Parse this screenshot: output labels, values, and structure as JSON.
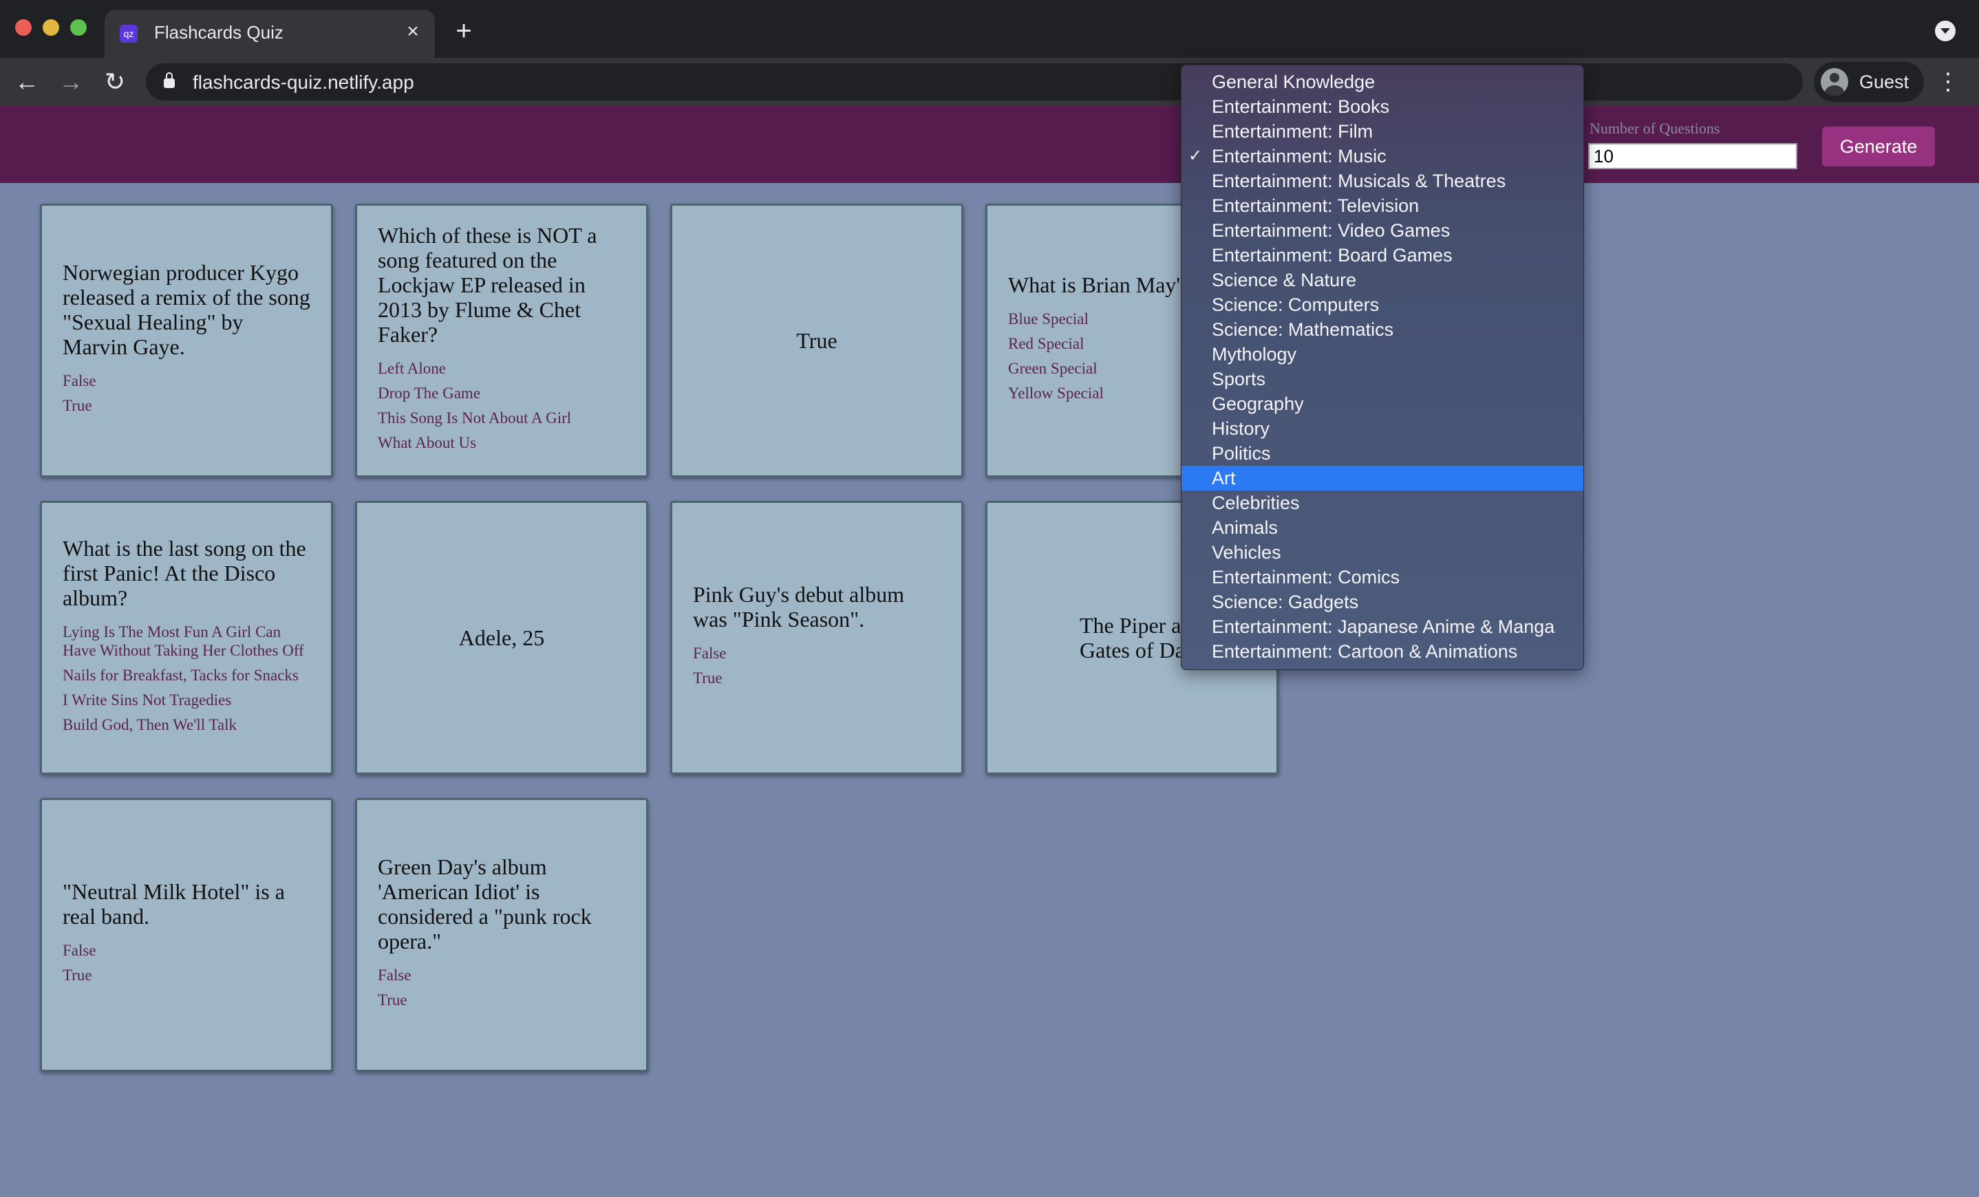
{
  "browser": {
    "tab_title": "Flashcards Quiz",
    "tab_close": "×",
    "new_tab": "+",
    "url": "flashcards-quiz.netlify.app",
    "profile_label": "Guest",
    "back": "←",
    "forward": "→",
    "reload": "↻",
    "menu": "⋮",
    "favicon": "qz"
  },
  "header": {
    "number_label": "Number of Questions",
    "number_value": "10",
    "generate_label": "Generate"
  },
  "category_dropdown": {
    "selected": "Entertainment: Music",
    "highlighted": "Art",
    "check": "✓",
    "options": [
      "General Knowledge",
      "Entertainment: Books",
      "Entertainment: Film",
      "Entertainment: Music",
      "Entertainment: Musicals & Theatres",
      "Entertainment: Television",
      "Entertainment: Video Games",
      "Entertainment: Board Games",
      "Science & Nature",
      "Science: Computers",
      "Science: Mathematics",
      "Mythology",
      "Sports",
      "Geography",
      "History",
      "Politics",
      "Art",
      "Celebrities",
      "Animals",
      "Vehicles",
      "Entertainment: Comics",
      "Science: Gadgets",
      "Entertainment: Japanese Anime & Manga",
      "Entertainment: Cartoon & Animations"
    ]
  },
  "cards": [
    {
      "question": "Norwegian producer Kygo released a remix of the song \"Sexual Healing\" by Marvin Gaye.",
      "options": [
        "False",
        "True"
      ]
    },
    {
      "question": "Which of these is NOT a song featured on the Lockjaw EP released in 2013 by Flume & Chet Faker?",
      "options": [
        "Left Alone",
        "Drop The Game",
        "This Song Is Not About A Girl",
        "What About Us"
      ]
    },
    {
      "answer": "True"
    },
    {
      "question": "What is Brian May' called?",
      "options": [
        "Blue Special",
        "Red Special",
        "Green Special",
        "Yellow Special"
      ]
    },
    {
      "question": "What is the last song on the first Panic! At the Disco album?",
      "options": [
        "Lying Is The Most Fun A Girl Can Have Without Taking Her Clothes Off",
        "Nails for Breakfast, Tacks for Snacks",
        "I Write Sins Not Tragedies",
        "Build God, Then We'll Talk"
      ]
    },
    {
      "answer": "Adele, 25"
    },
    {
      "question": "Pink Guy's debut album was \"Pink Season\".",
      "options": [
        "False",
        "True"
      ]
    },
    {
      "answer": "The Piper at the Gates of Dawn"
    },
    {
      "question": "\"Neutral Milk Hotel\" is a real band.",
      "options": [
        "False",
        "True"
      ]
    },
    {
      "question": "Green Day's album 'American Idiot' is considered a \"punk rock opera.\"",
      "options": [
        "False",
        "True"
      ]
    }
  ]
}
